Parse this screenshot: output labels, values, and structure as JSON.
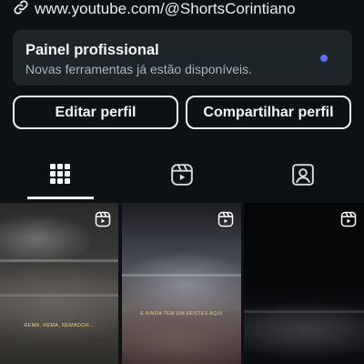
{
  "profile": {
    "link_text": "www.youtube.com/@ShortsCorintiano",
    "link_icon": "link-icon"
  },
  "pro_panel": {
    "title": "Painel profissional",
    "subtitle": "Novas ferramentas já estão disponíveis.",
    "dot_color": "#5b6cf0"
  },
  "actions": {
    "edit_label": "Editar perfil",
    "share_label": "Compartilhar perfil"
  },
  "tabs": [
    {
      "icon": "grid-icon",
      "selected": true
    },
    {
      "icon": "reels-icon",
      "selected": false
    },
    {
      "icon": "tagged-icon",
      "selected": false
    }
  ],
  "posts": [
    {
      "type": "reel",
      "caption": "REMA, REMA, REMADOR..."
    },
    {
      "type": "reel",
      "caption": "E AINDA TEM UM DESTES AQUI"
    },
    {
      "type": "reel",
      "caption": ""
    }
  ],
  "colors": {
    "background": "#0e1114",
    "panel": "#1e2529",
    "text": "#f2f4f5",
    "muted_text": "#aeb6bb",
    "accent_dot": "#5b6cf0"
  }
}
